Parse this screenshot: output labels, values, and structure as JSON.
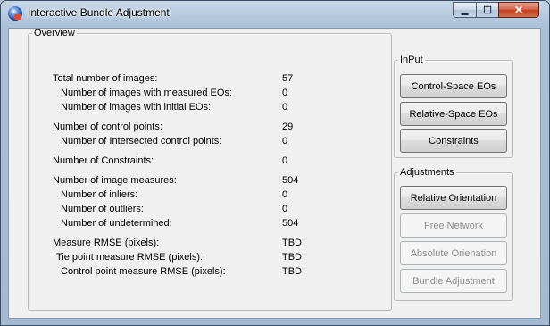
{
  "window": {
    "title": "Interactive Bundle Adjustment",
    "min_glyph": "▬",
    "max_glyph": "☐",
    "close_glyph": "✕"
  },
  "overview": {
    "legend": "Overview",
    "rows": [
      {
        "label": "Total number of images:",
        "value": "57"
      },
      {
        "label": "Number of images with measured EOs:",
        "value": "0"
      },
      {
        "label": "Number of images with initial EOs:",
        "value": "0"
      },
      {
        "label": "Number of control points:",
        "value": "29"
      },
      {
        "label": "Number of Intersected control points:",
        "value": "0"
      },
      {
        "label": "Number of Constraints:",
        "value": "0"
      },
      {
        "label": "Number of image measures:",
        "value": "504"
      },
      {
        "label": "Number of inliers:",
        "value": "0"
      },
      {
        "label": "Number of outliers:",
        "value": "0"
      },
      {
        "label": "Number of undetermined:",
        "value": "504"
      },
      {
        "label": "Measure RMSE (pixels):",
        "value": "TBD"
      },
      {
        "label": "Tie point measure RMSE (pixels):",
        "value": "TBD"
      },
      {
        "label": "Control point measure RMSE (pixels):",
        "value": "TBD"
      }
    ]
  },
  "input": {
    "legend": "InPut",
    "buttons": [
      {
        "label": "Control-Space EOs",
        "enabled": true
      },
      {
        "label": "Relative-Space EOs",
        "enabled": true
      },
      {
        "label": "Constraints",
        "enabled": true
      }
    ]
  },
  "adjustments": {
    "legend": "Adjustments",
    "buttons": [
      {
        "label": "Relative Orientation",
        "enabled": true
      },
      {
        "label": "Free Network",
        "enabled": false
      },
      {
        "label": "Absolute Orienation",
        "enabled": false
      },
      {
        "label": "Bundle Adjustment",
        "enabled": false
      }
    ]
  }
}
